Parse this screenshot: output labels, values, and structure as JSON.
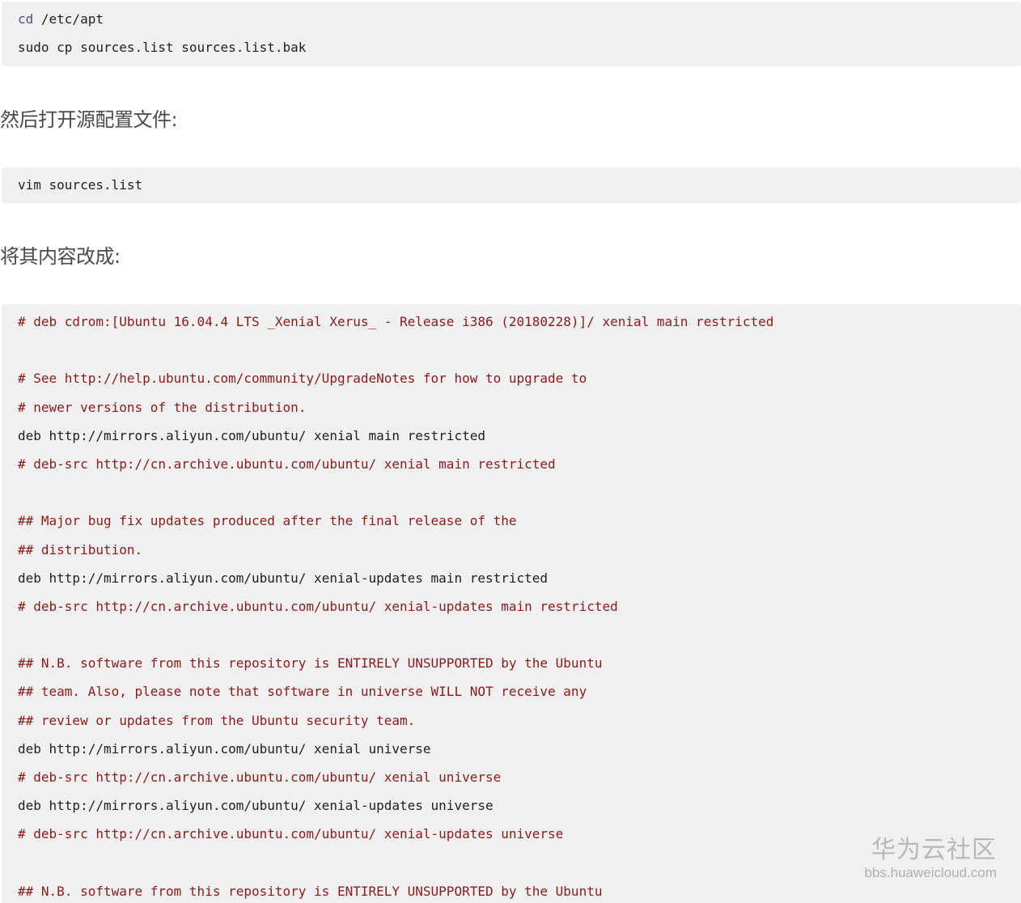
{
  "blocks": {
    "backup": {
      "lines": [
        {
          "prefix": "cd",
          "text": " /etc/apt"
        },
        {
          "prefix": "",
          "text": "sudo cp sources.list sources.list.bak"
        }
      ]
    },
    "open": {
      "lines": [
        {
          "text": "vim sources.list"
        }
      ]
    },
    "sources": {
      "lines": [
        "# deb cdrom:[Ubuntu 16.04.4 LTS _Xenial Xerus_ - Release i386 (20180228)]/ xenial main restricted",
        "",
        "# See http://help.ubuntu.com/community/UpgradeNotes for how to upgrade to",
        "# newer versions of the distribution.",
        "deb http://mirrors.aliyun.com/ubuntu/ xenial main restricted",
        "# deb-src http://cn.archive.ubuntu.com/ubuntu/ xenial main restricted",
        "",
        "## Major bug fix updates produced after the final release of the",
        "## distribution.",
        "deb http://mirrors.aliyun.com/ubuntu/ xenial-updates main restricted",
        "# deb-src http://cn.archive.ubuntu.com/ubuntu/ xenial-updates main restricted",
        "",
        "## N.B. software from this repository is ENTIRELY UNSUPPORTED by the Ubuntu",
        "## team. Also, please note that software in universe WILL NOT receive any",
        "## review or updates from the Ubuntu security team.",
        "deb http://mirrors.aliyun.com/ubuntu/ xenial universe",
        "# deb-src http://cn.archive.ubuntu.com/ubuntu/ xenial universe",
        "deb http://mirrors.aliyun.com/ubuntu/ xenial-updates universe",
        "# deb-src http://cn.archive.ubuntu.com/ubuntu/ xenial-updates universe",
        "",
        "## N.B. software from this repository is ENTIRELY UNSUPPORTED by the Ubuntu"
      ]
    }
  },
  "prose": {
    "open_config": "然后打开源配置文件:",
    "change_content": "将其内容改成:"
  },
  "watermark": {
    "title": "华为云社区",
    "url": "bbs.huaweicloud.com"
  },
  "colors": {
    "code_background": "#f0f0f0",
    "comment": "#8b1a1a",
    "code_text": "#1f1f1f",
    "prose_text": "#4a4a4a",
    "watermark": "#b8b8b8"
  }
}
